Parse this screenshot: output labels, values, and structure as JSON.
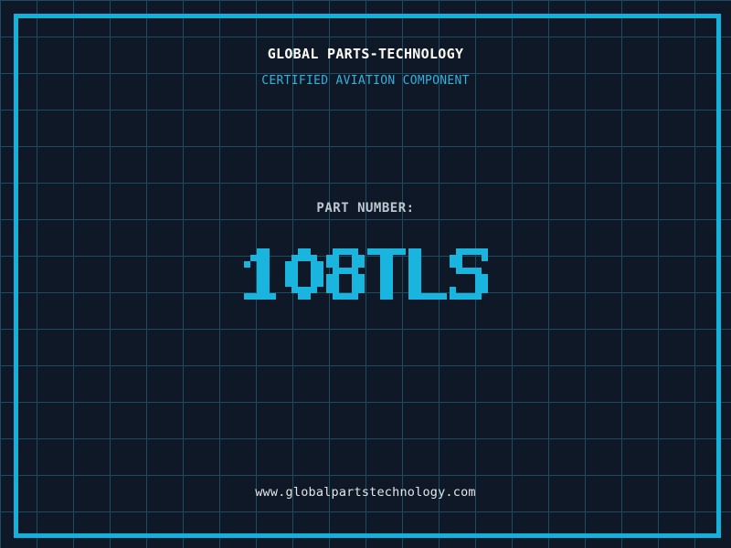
{
  "header": {
    "title": "GLOBAL PARTS-TECHNOLOGY",
    "subtitle": "CERTIFIED AVIATION COMPONENT"
  },
  "part": {
    "label": "PART NUMBER:",
    "number": "108TLS"
  },
  "footer": {
    "website": "www.globalpartstechnology.com"
  },
  "colors": {
    "background": "#0e1826",
    "grid_line": "#1b4c63",
    "frame_border": "#12b2da",
    "title_text": "#ffffff",
    "subtitle_text": "#35b1dd",
    "label_text": "#bcc7d0",
    "part_number_text": "#1ab5de",
    "website_text": "#e4e7ea"
  }
}
